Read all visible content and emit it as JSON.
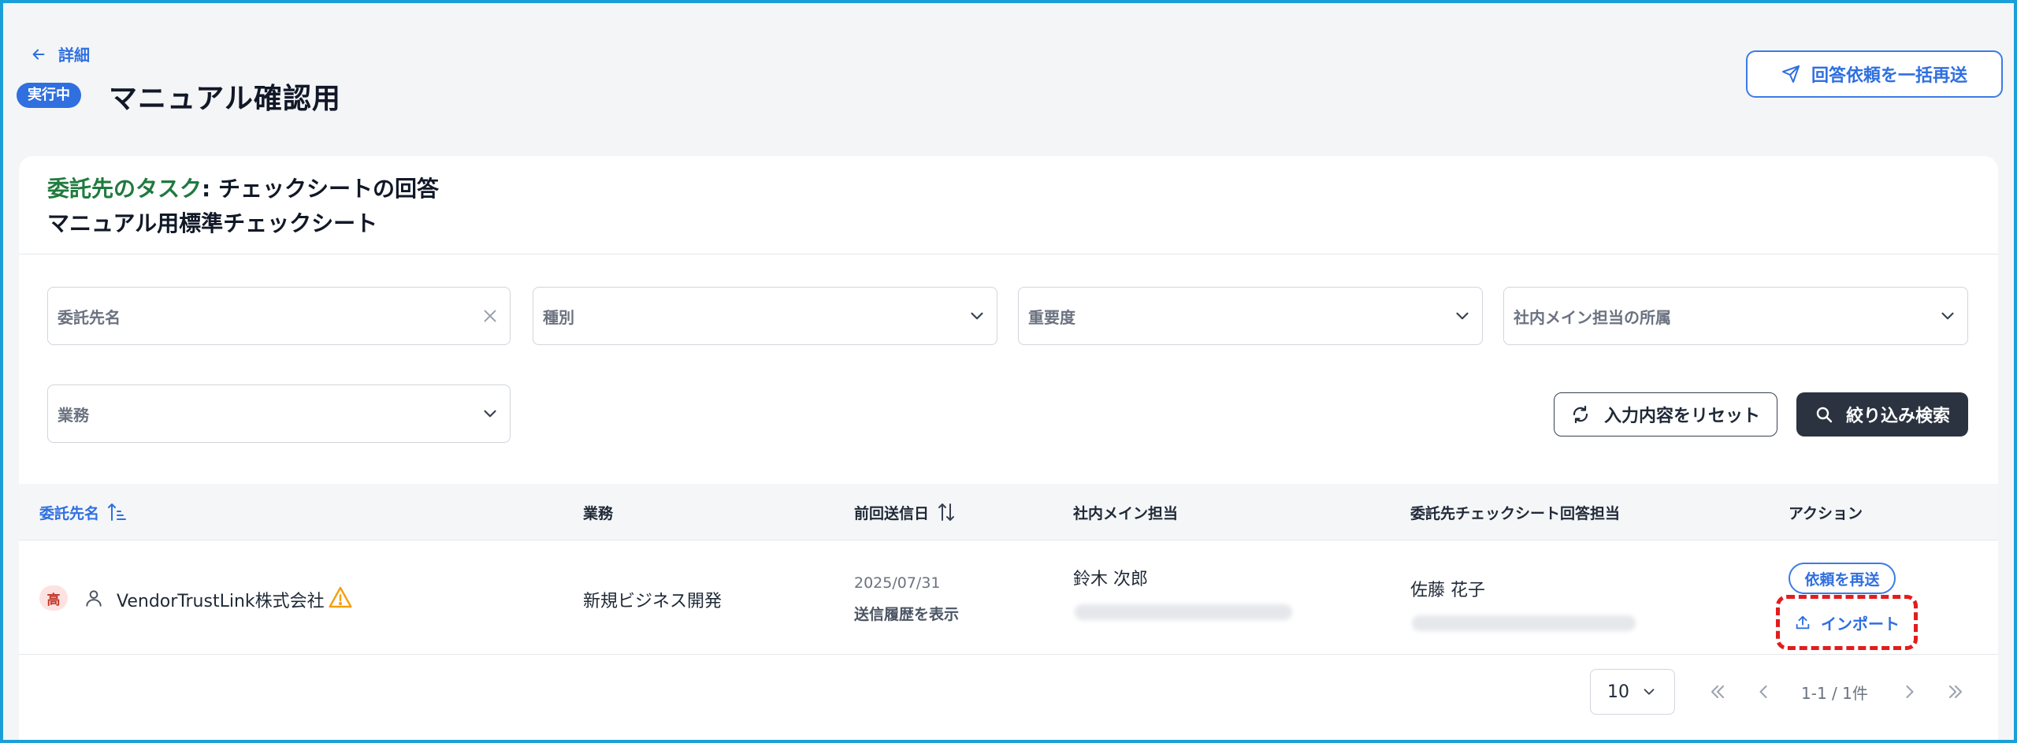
{
  "header": {
    "back_label": "詳細",
    "status": "実行中",
    "title": "マニュアル確認用",
    "bulk_resend_label": "回答依頼を一括再送"
  },
  "card": {
    "task_prefix": "委託先のタスク",
    "task_suffix": ": チェックシートの回答",
    "sheet_name": "マニュアル用標準チェックシート"
  },
  "filters": {
    "vendor": "委託先名",
    "type": "種別",
    "severity": "重要度",
    "department": "社内メイン担当の所属",
    "business": "業務",
    "reset_label": "入力内容をリセット",
    "search_label": "絞り込み検索"
  },
  "table": {
    "columns": [
      "委託先名",
      "業務",
      "前回送信日",
      "社内メイン担当",
      "委託先チェックシート回答担当",
      "アクション"
    ],
    "rows": [
      {
        "priority": "高",
        "vendor": "VendorTrustLink株式会社",
        "business": "新規ビジネス開発",
        "last_sent": "2025/07/31",
        "history_label": "送信履歴を表示",
        "main_contact": "鈴木 次郎",
        "responder": "佐藤 花子",
        "resend_label": "依頼を再送",
        "import_label": "インポート"
      }
    ]
  },
  "pagination": {
    "page_size": "10",
    "info": "1-1 / 1件"
  },
  "colors": {
    "accent": "#2f6fe0",
    "task_green": "#1f7a3e",
    "highlight_red": "#e11d1d",
    "dark_button": "#2b3340"
  }
}
